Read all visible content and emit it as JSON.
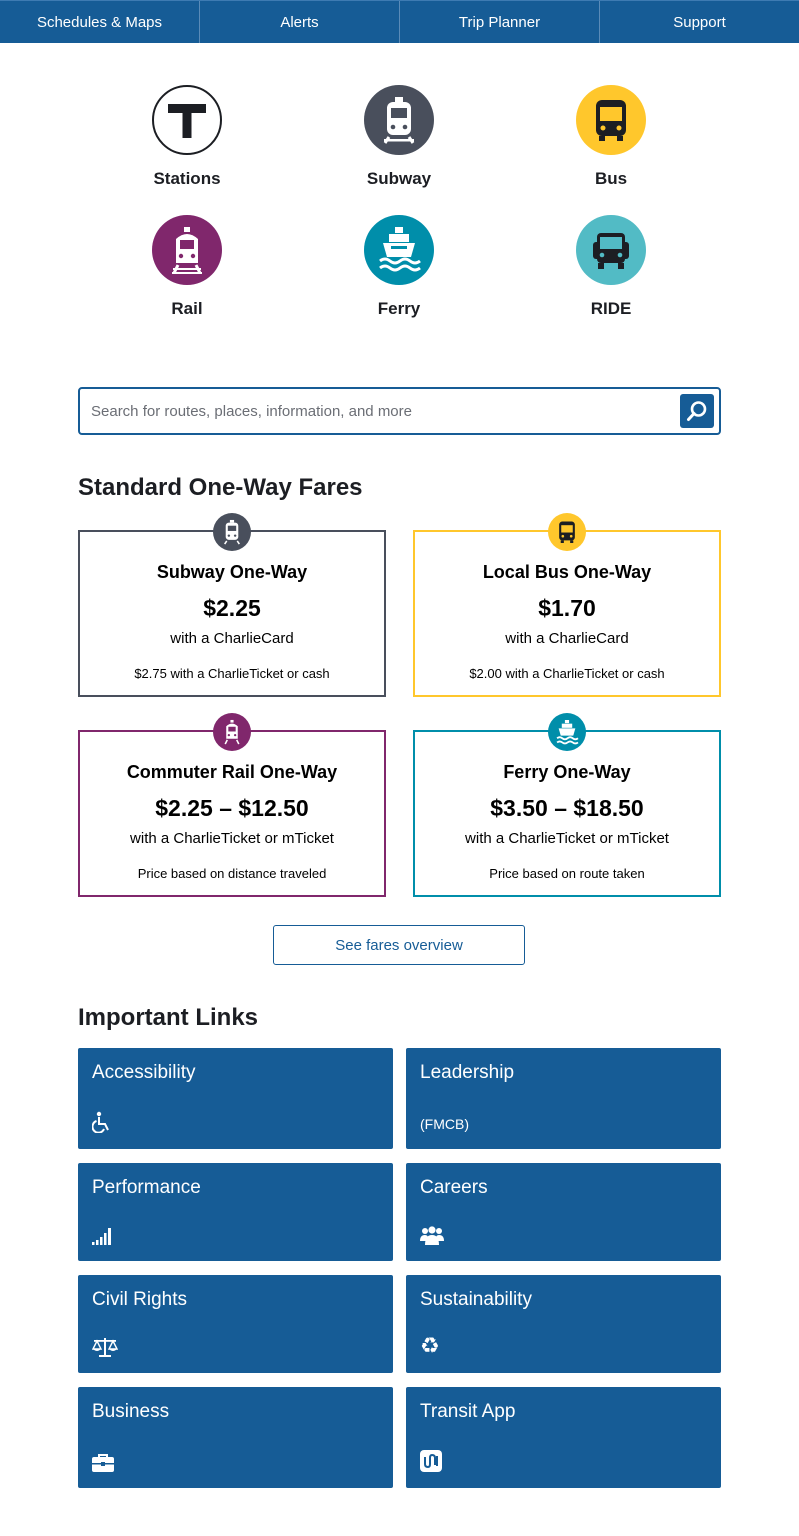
{
  "nav": {
    "items": [
      "Schedules & Maps",
      "Alerts",
      "Trip Planner",
      "Support"
    ]
  },
  "modes": [
    {
      "label": "Stations",
      "icon": "t-logo-icon",
      "color": "#ffffff"
    },
    {
      "label": "Subway",
      "icon": "subway-train-icon",
      "color": "#494f5c"
    },
    {
      "label": "Bus",
      "icon": "bus-icon",
      "color": "#ffc72c"
    },
    {
      "label": "Rail",
      "icon": "commuter-rail-icon",
      "color": "#80276c"
    },
    {
      "label": "Ferry",
      "icon": "ferry-icon",
      "color": "#008eaa"
    },
    {
      "label": "RIDE",
      "icon": "ride-van-icon",
      "color": "#52bbc5"
    }
  ],
  "search": {
    "placeholder": "Search for routes, places, information, and more"
  },
  "fares": {
    "heading": "Standard One-Way Fares",
    "cards": [
      {
        "title": "Subway One-Way",
        "price": "$2.25",
        "note": "with a CharlieCard",
        "sub": "$2.75 with a CharlieTicket or cash",
        "color": "#494f5c",
        "icon": "subway-train-icon"
      },
      {
        "title": "Local Bus One-Way",
        "price": "$1.70",
        "note": "with a CharlieCard",
        "sub": "$2.00 with a CharlieTicket or cash",
        "color": "#ffc72c",
        "icon": "bus-icon"
      },
      {
        "title": "Commuter Rail One-Way",
        "price": "$2.25 – $12.50",
        "note": "with a CharlieTicket or mTicket",
        "sub": "Price based on distance traveled",
        "color": "#80276c",
        "icon": "commuter-rail-icon"
      },
      {
        "title": "Ferry One-Way",
        "price": "$3.50 – $18.50",
        "note": "with a CharlieTicket or mTicket",
        "sub": "Price based on route taken",
        "color": "#008eaa",
        "icon": "ferry-icon"
      }
    ],
    "overview_button": "See fares overview"
  },
  "links": {
    "heading": "Important Links",
    "tiles": [
      {
        "title": "Accessibility",
        "icon": "wheelchair-icon",
        "icon_text": ""
      },
      {
        "title": "Leadership",
        "icon": "",
        "icon_text": "(FMCB)"
      },
      {
        "title": "Performance",
        "icon": "signal-bars-icon",
        "icon_text": ""
      },
      {
        "title": "Careers",
        "icon": "people-group-icon",
        "icon_text": ""
      },
      {
        "title": "Civil Rights",
        "icon": "balance-scale-icon",
        "icon_text": ""
      },
      {
        "title": "Sustainability",
        "icon": "recycle-icon",
        "icon_text": ""
      },
      {
        "title": "Business",
        "icon": "briefcase-icon",
        "icon_text": ""
      },
      {
        "title": "Transit App",
        "icon": "transit-app-icon",
        "icon_text": ""
      }
    ]
  }
}
